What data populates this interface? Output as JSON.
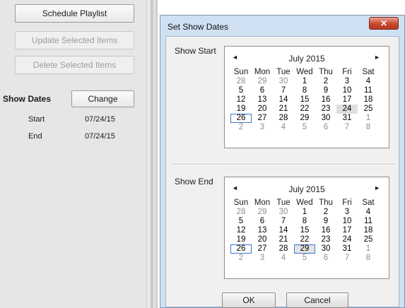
{
  "left_panel": {
    "schedule_button": "Schedule Playlist",
    "update_button": "Update Selected Items",
    "delete_button": "Delete Selected Items",
    "show_dates_label": "Show Dates",
    "change_button": "Change",
    "start_label": "Start",
    "start_value": "07/24/15",
    "end_label": "End",
    "end_value": "07/24/15"
  },
  "dialog": {
    "title": "Set Show Dates",
    "close_glyph": "✕",
    "show_start_label": "Show Start",
    "show_end_label": "Show End",
    "ok_label": "OK",
    "cancel_label": "Cancel"
  },
  "calendar_common": {
    "prev_glyph": "◄",
    "next_glyph": "►",
    "day_headers": [
      "Sun",
      "Mon",
      "Tue",
      "Wed",
      "Thu",
      "Fri",
      "Sat"
    ]
  },
  "start_calendar": {
    "month": "July 2015",
    "selected_day": "24",
    "today_day": "26"
  },
  "end_calendar": {
    "month": "July 2015",
    "selected_day": "29",
    "today_day": "26"
  },
  "month_days": [
    {
      "d": "28",
      "other": true
    },
    {
      "d": "29",
      "other": true
    },
    {
      "d": "30",
      "other": true
    },
    {
      "d": "1"
    },
    {
      "d": "2"
    },
    {
      "d": "3"
    },
    {
      "d": "4"
    },
    {
      "d": "5"
    },
    {
      "d": "6"
    },
    {
      "d": "7"
    },
    {
      "d": "8"
    },
    {
      "d": "9"
    },
    {
      "d": "10"
    },
    {
      "d": "11"
    },
    {
      "d": "12"
    },
    {
      "d": "13"
    },
    {
      "d": "14"
    },
    {
      "d": "15"
    },
    {
      "d": "16"
    },
    {
      "d": "17"
    },
    {
      "d": "18"
    },
    {
      "d": "19"
    },
    {
      "d": "20"
    },
    {
      "d": "21"
    },
    {
      "d": "22"
    },
    {
      "d": "23"
    },
    {
      "d": "24"
    },
    {
      "d": "25"
    },
    {
      "d": "26"
    },
    {
      "d": "27"
    },
    {
      "d": "28"
    },
    {
      "d": "29"
    },
    {
      "d": "30"
    },
    {
      "d": "31"
    },
    {
      "d": "1",
      "other": true
    },
    {
      "d": "2",
      "other": true
    },
    {
      "d": "3",
      "other": true
    },
    {
      "d": "4",
      "other": true
    },
    {
      "d": "5",
      "other": true
    },
    {
      "d": "6",
      "other": true
    },
    {
      "d": "7",
      "other": true
    },
    {
      "d": "8",
      "other": true
    }
  ],
  "colors": {
    "selection_border": "#3d7ac6",
    "close_button_red": "#c9462e",
    "dialog_frame": "#cfe0f2"
  }
}
